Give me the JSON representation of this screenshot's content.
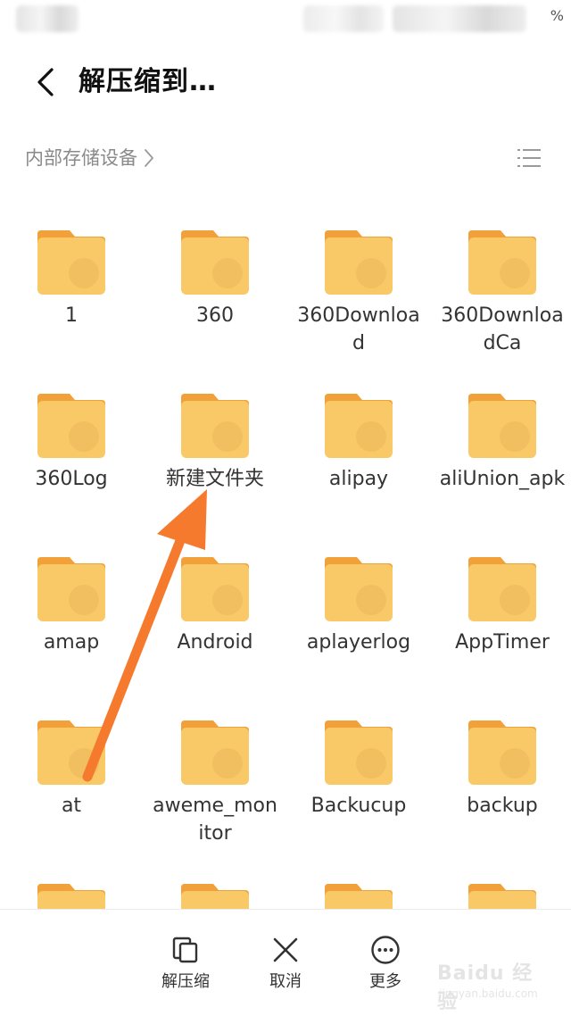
{
  "status_bar": {
    "battery_text": "%"
  },
  "header": {
    "title": "解压缩到…"
  },
  "breadcrumb": {
    "label": "内部存储设备"
  },
  "folder_color": "#F9C968",
  "folder_tab_color": "#F2A13A",
  "arrow_color": "#F57A2E",
  "folders": [
    {
      "name": "1"
    },
    {
      "name": "360"
    },
    {
      "name": "360Download"
    },
    {
      "name": "360DownloadCa"
    },
    {
      "name": "360Log"
    },
    {
      "name": "新建文件夹"
    },
    {
      "name": "alipay"
    },
    {
      "name": "aliUnion_apk"
    },
    {
      "name": "amap"
    },
    {
      "name": "Android"
    },
    {
      "name": "aplayerlog"
    },
    {
      "name": "AppTimer"
    },
    {
      "name": "at"
    },
    {
      "name": "aweme_monitor"
    },
    {
      "name": "Backucup"
    },
    {
      "name": "backup"
    },
    {
      "name": ""
    },
    {
      "name": ""
    },
    {
      "name": ""
    },
    {
      "name": ""
    }
  ],
  "bottom_bar": {
    "extract_label": "解压缩",
    "cancel_label": "取消",
    "more_label": "更多"
  },
  "watermark": {
    "brand": "Baidu 经验",
    "sub": "jingyan.baidu.com"
  }
}
